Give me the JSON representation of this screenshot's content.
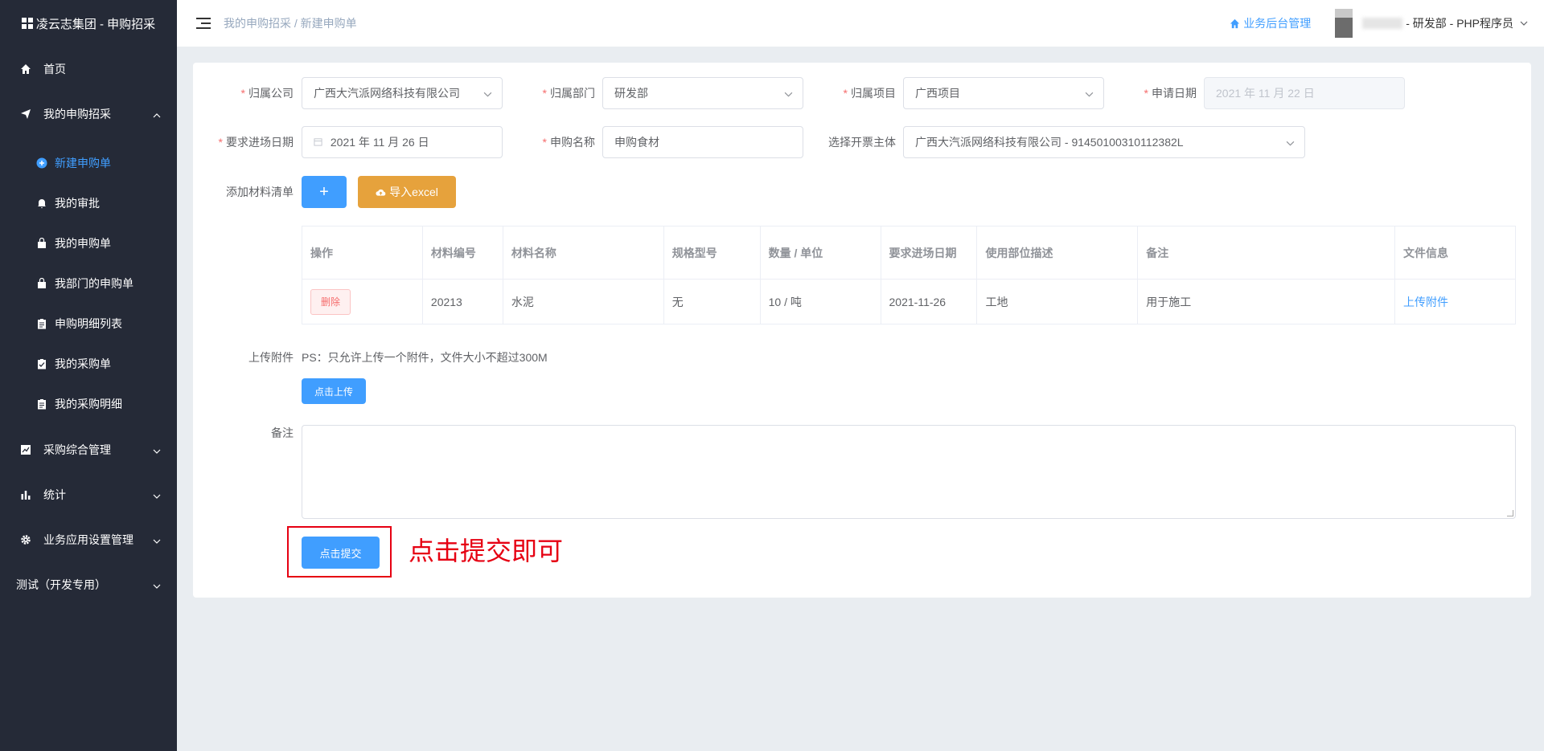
{
  "brand": {
    "title": "凌云志集团 - 申购招采"
  },
  "sidebar": {
    "home": "首页",
    "my_procurement": "我的申购招采",
    "sub_items": [
      {
        "label": "新建申购单",
        "icon": "plus-circle-icon"
      },
      {
        "label": "我的审批",
        "icon": "bell-icon"
      },
      {
        "label": "我的申购单",
        "icon": "bag-icon"
      },
      {
        "label": "我部门的申购单",
        "icon": "bag-icon"
      },
      {
        "label": "申购明细列表",
        "icon": "clipboard-icon"
      },
      {
        "label": "我的采购单",
        "icon": "clipboard-check-icon"
      },
      {
        "label": "我的采购明细",
        "icon": "clipboard-icon"
      }
    ],
    "procurement_mgmt": "采购综合管理",
    "stats": "统计",
    "app_settings": "业务应用设置管理",
    "test": "测试（开发专用）"
  },
  "header": {
    "breadcrumb_parent": "我的申购招采",
    "breadcrumb_sep": " / ",
    "breadcrumb_current": "新建申购单",
    "back_office": "业务后台管理",
    "user": "- 研发部 - PHP程序员"
  },
  "form": {
    "company_label": "归属公司",
    "company_value": "广西大汽派网络科技有限公司",
    "dept_label": "归属部门",
    "dept_value": "研发部",
    "project_label": "归属项目",
    "project_value": "广西项目",
    "apply_date_label": "申请日期",
    "apply_date_value": "2021 年 11 月 22 日",
    "entry_date_label": "要求进场日期",
    "entry_date_value": "2021 年 11 月 26 日",
    "purchase_name_label": "申购名称",
    "purchase_name_value": "申购食材",
    "invoice_label": "选择开票主体",
    "invoice_value": "广西大汽派网络科技有限公司 - 91450100310112382L",
    "materials_label": "添加材料清单",
    "add_btn": "+",
    "import_btn": "导入excel",
    "upload_label": "上传附件",
    "upload_hint": "PS：只允许上传一个附件，文件大小不超过300M",
    "upload_btn": "点击上传",
    "remark_label": "备注",
    "submit_btn": "点击提交"
  },
  "table": {
    "headers": [
      "操作",
      "材料编号",
      "材料名称",
      "规格型号",
      "数量 / 单位",
      "要求进场日期",
      "使用部位描述",
      "备注",
      "文件信息"
    ],
    "rows": [
      {
        "action": "删除",
        "code": "20213",
        "name": "水泥",
        "spec": "无",
        "qty": "10 / 吨",
        "date": "2021-11-26",
        "location": "工地",
        "remark": "用于施工",
        "file": "上传附件"
      }
    ]
  },
  "annotation": {
    "text": "点击提交即可",
    "color": "#e60012"
  },
  "colors": {
    "accent": "#409eff",
    "sidebar_bg": "#252a37",
    "warning": "#e6a23c",
    "danger": "#f56c6c"
  }
}
